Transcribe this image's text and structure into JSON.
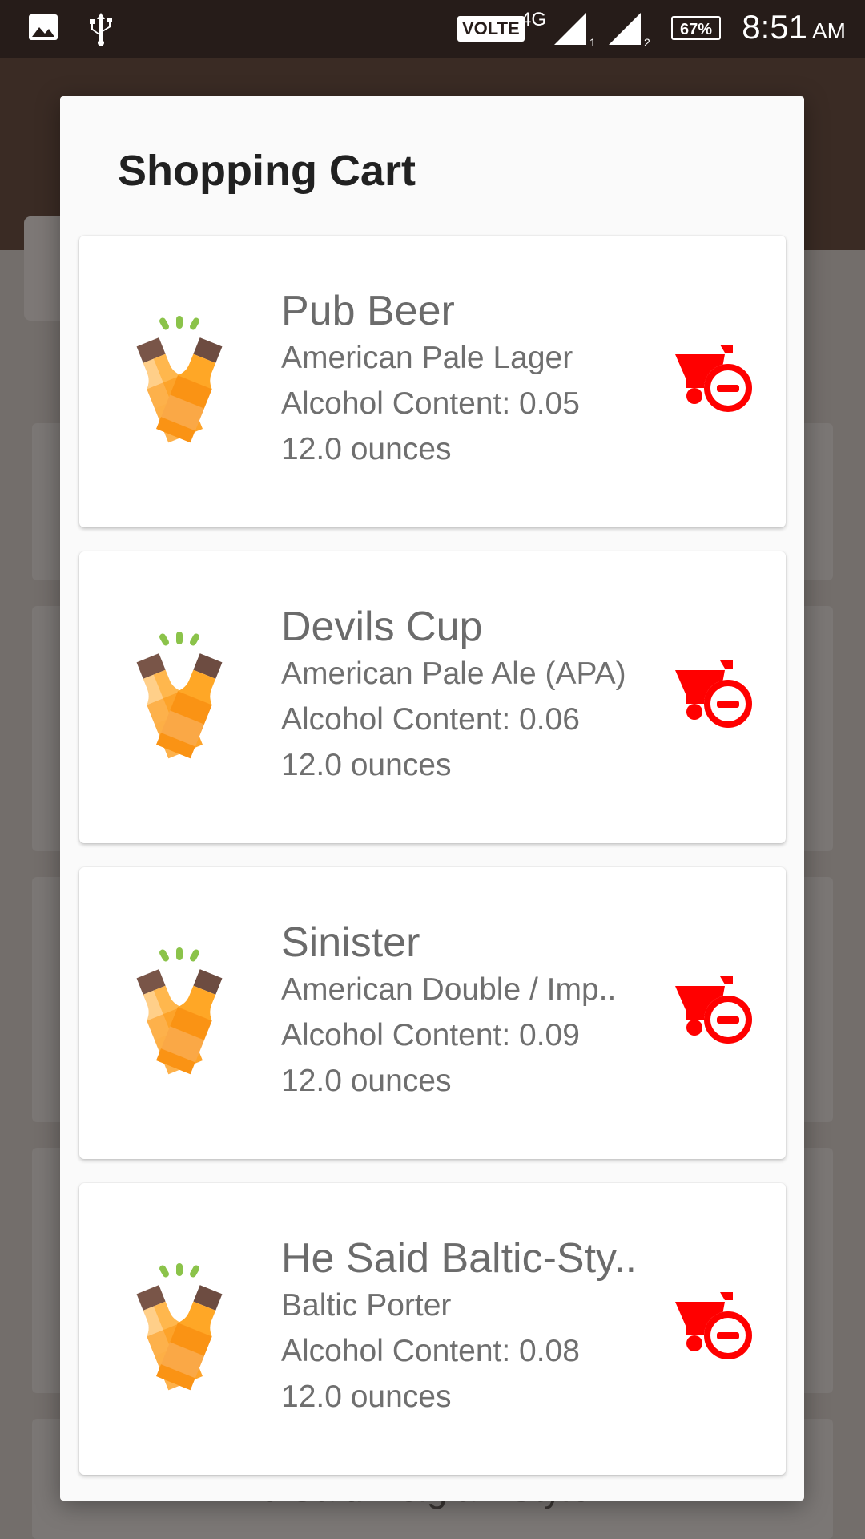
{
  "status_bar": {
    "volte": "VOLTE",
    "network": "4G",
    "sim1": "1",
    "sim2": "2",
    "battery": "67%",
    "time": "8:51",
    "ampm": "AM"
  },
  "dialog": {
    "title": "Shopping Cart",
    "items": [
      {
        "name": "Pub Beer",
        "style": "American Pale Lager",
        "alcohol": "Alcohol Content: 0.05",
        "size": "12.0 ounces"
      },
      {
        "name": "Devils Cup",
        "style": "American Pale Ale (APA)",
        "alcohol": "Alcohol Content: 0.06",
        "size": "12.0 ounces"
      },
      {
        "name": "Sinister",
        "style": "American Double / Imp..",
        "alcohol": "Alcohol Content: 0.09",
        "size": "12.0 ounces"
      },
      {
        "name": "He Said Baltic-Sty..",
        "style": "Baltic Porter",
        "alcohol": "Alcohol Content: 0.08",
        "size": "12.0 ounces"
      }
    ]
  },
  "background": {
    "partial_item_name": "He Said Belgian-Style T.."
  },
  "colors": {
    "status_bar": "#261c19",
    "remove_icon": "#ff0000",
    "beer_orange": "#fb8c00",
    "beer_cap": "#795548",
    "sparkle": "#7cb342"
  },
  "icons": {
    "item": "beer-bottles-cheers-icon",
    "remove": "cart-remove-icon"
  }
}
